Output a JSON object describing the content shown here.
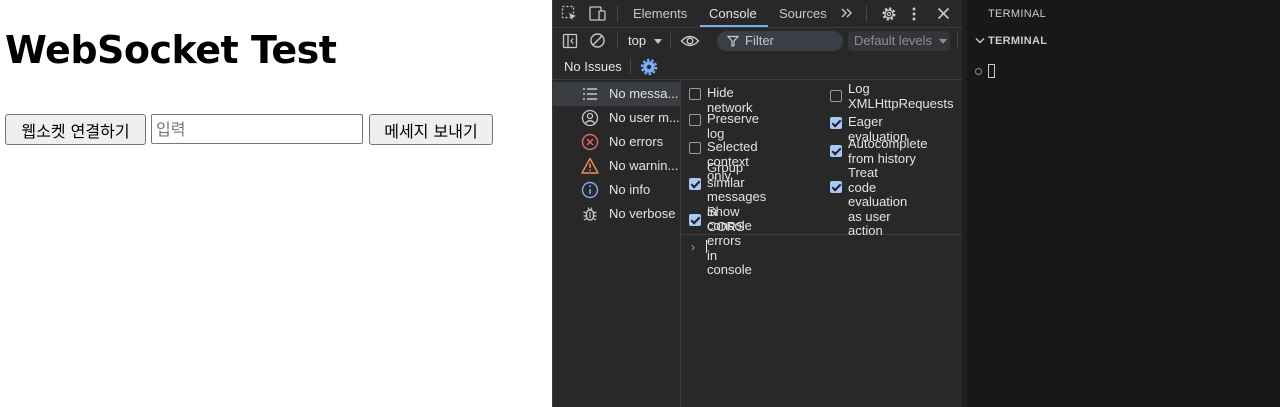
{
  "webpage": {
    "title": "WebSocket Test",
    "connect_button": "웹소켓 연결하기",
    "message_placeholder": "입력",
    "send_button": "메세지 보내기"
  },
  "devtools": {
    "tabs": [
      "Elements",
      "Console",
      "Sources"
    ],
    "active_tab": "Console",
    "toolbar": {
      "context": "top",
      "filter_placeholder": "Filter",
      "levels": "Default levels"
    },
    "issues_label": "No Issues",
    "sidebar": [
      {
        "label": "No messa...",
        "icon": "list-icon",
        "selected": true
      },
      {
        "label": "No user m...",
        "icon": "user-icon",
        "selected": false
      },
      {
        "label": "No errors",
        "icon": "error-icon",
        "selected": false
      },
      {
        "label": "No warnin...",
        "icon": "warning-icon",
        "selected": false
      },
      {
        "label": "No info",
        "icon": "info-icon",
        "selected": false
      },
      {
        "label": "No verbose",
        "icon": "bug-icon",
        "selected": false
      }
    ],
    "settings_left": [
      {
        "label": "Hide network",
        "checked": false
      },
      {
        "label": "Preserve log",
        "checked": false
      },
      {
        "label": "Selected context\nonly",
        "checked": false
      },
      {
        "label": "Group similar\nmessages in\nconsole",
        "checked": true
      },
      {
        "label": "Show CORS errors\nin console",
        "checked": true
      }
    ],
    "settings_right": [
      {
        "label": "Log\nXMLHttpRequests",
        "checked": false
      },
      {
        "label": "Eager evaluation",
        "checked": true
      },
      {
        "label": "Autocomplete\nfrom history",
        "checked": true
      },
      {
        "label": "Treat code\nevaluation as user\naction",
        "checked": true
      }
    ],
    "colors": {
      "background": "#282828",
      "accent": "#7cacf8",
      "checkbox_checked": "#a8c7fa",
      "error": "#e46962",
      "warning": "#f28b54"
    }
  },
  "terminal": {
    "title": "TERMINAL",
    "section": "TERMINAL"
  }
}
